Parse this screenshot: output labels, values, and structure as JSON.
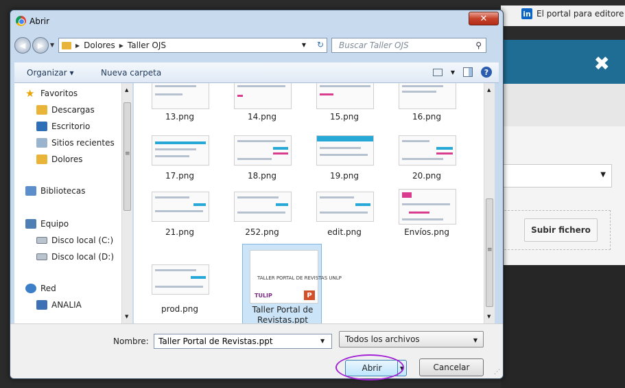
{
  "background": {
    "browser_tab": "El portal para editore",
    "linkedin_icon": "linkedin-icon",
    "close_symbol": "✖",
    "upload_button": "Subir fichero"
  },
  "dialog": {
    "title": "Abrir",
    "close_symbol": "✕",
    "address": {
      "path": [
        "Dolores",
        "Taller OJS"
      ],
      "search_placeholder": "Buscar Taller OJS"
    },
    "toolbar": {
      "organize_label": "Organizar ▾",
      "new_folder_label": "Nueva carpeta"
    },
    "nav": {
      "favorites": "Favoritos",
      "downloads": "Descargas",
      "desktop": "Escritorio",
      "recent": "Sitios recientes",
      "dolores": "Dolores",
      "libraries": "Bibliotecas",
      "computer": "Equipo",
      "disk_c": "Disco local (C:)",
      "disk_d": "Disco local (D:)",
      "network": "Red",
      "network_pc": "ANALIA"
    },
    "files": [
      {
        "name": "13.png"
      },
      {
        "name": "14.png"
      },
      {
        "name": "15.png"
      },
      {
        "name": "16.png"
      },
      {
        "name": "17.png"
      },
      {
        "name": "18.png"
      },
      {
        "name": "19.png"
      },
      {
        "name": "20.png"
      },
      {
        "name": "21.png"
      },
      {
        "name": "252.png"
      },
      {
        "name": "edit.png"
      },
      {
        "name": "Envíos.png"
      },
      {
        "name": "prod.png"
      },
      {
        "name": "Taller Portal de Revistas.ppt",
        "selected": true,
        "thumb_text": "TALLER PORTAL DE REVISTAS UNLP",
        "thumb_logo": "TULIP"
      }
    ],
    "bottom": {
      "filename_label": "Nombre:",
      "filename_value": "Taller Portal de Revistas.ppt",
      "filter_value": "Todos los archivos",
      "open_label": "Abrir",
      "cancel_label": "Cancelar"
    }
  },
  "colors": {
    "accent_header": "#1f6d94",
    "annotation_circle": "#a321d6",
    "selection": "#cce4f7"
  }
}
